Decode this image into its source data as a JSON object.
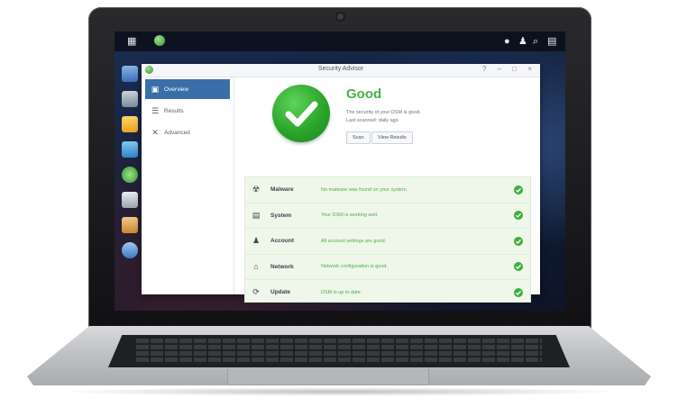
{
  "window": {
    "title": "Security Advisor",
    "controls": "? – □ ×"
  },
  "taskbar": {
    "icons": [
      "grid-icon",
      "app-icon",
      "chat-icon",
      "user-icon",
      "search-icon",
      "widgets-icon"
    ]
  },
  "sidebar": {
    "items": [
      {
        "label": "Overview",
        "icon": "overview-icon",
        "active": true
      },
      {
        "label": "Results",
        "icon": "list-icon",
        "active": false
      },
      {
        "label": "Advanced",
        "icon": "tools-icon",
        "active": false
      }
    ]
  },
  "status": {
    "title": "Good",
    "line1": "The security of your DSM is good.",
    "line2": "Last scanned: daily ago",
    "scan_label": "Scan",
    "view_results_label": "View Results"
  },
  "checks": [
    {
      "name": "Malware",
      "desc": "No malware was found on your system.",
      "icon": "malware-icon"
    },
    {
      "name": "System",
      "desc": "Your DSM is working well.",
      "icon": "system-icon"
    },
    {
      "name": "Account",
      "desc": "All account settings are good.",
      "icon": "account-icon"
    },
    {
      "name": "Network",
      "desc": "Network configuration is good.",
      "icon": "network-icon"
    },
    {
      "name": "Update",
      "desc": "DSM is up to date.",
      "icon": "update-icon"
    }
  ],
  "colors": {
    "accent": "#3a6ea8",
    "good": "#48b042",
    "check_bg": "#eef7ea"
  }
}
